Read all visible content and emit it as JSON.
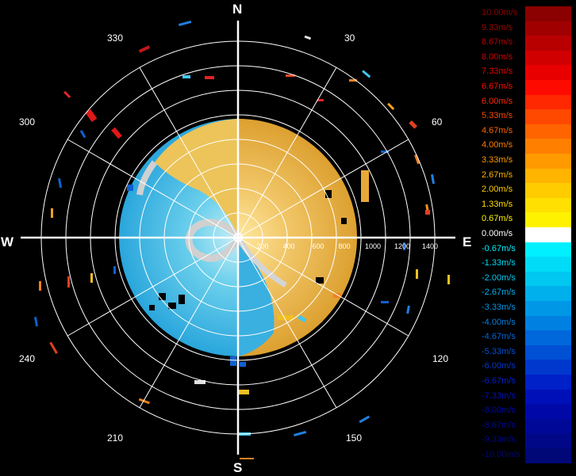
{
  "compass": {
    "n": "N",
    "e": "E",
    "s": "S",
    "w": "W"
  },
  "bearings": [
    "30",
    "60",
    "120",
    "150",
    "210",
    "240",
    "300",
    "330"
  ],
  "range_labels": [
    "200",
    "400",
    "600",
    "800",
    "1000",
    "1200",
    "1400"
  ],
  "legend": [
    {
      "label": "10.00m/s",
      "color": "#8b0000"
    },
    {
      "label": "9.33m/s",
      "color": "#a00000"
    },
    {
      "label": "8.67m/s",
      "color": "#b80000"
    },
    {
      "label": "8.00m/s",
      "color": "#d00000"
    },
    {
      "label": "7.33m/s",
      "color": "#e80000"
    },
    {
      "label": "6.67m/s",
      "color": "#ff0a00"
    },
    {
      "label": "6.00m/s",
      "color": "#ff2800"
    },
    {
      "label": "5.33m/s",
      "color": "#ff4800"
    },
    {
      "label": "4.67m/s",
      "color": "#ff6400"
    },
    {
      "label": "4.00m/s",
      "color": "#ff7f00"
    },
    {
      "label": "3.33m/s",
      "color": "#ff9a00"
    },
    {
      "label": "2.67m/s",
      "color": "#ffb400"
    },
    {
      "label": "2.00m/s",
      "color": "#ffcc00"
    },
    {
      "label": "1.33m/s",
      "color": "#ffe000"
    },
    {
      "label": "0.67m/s",
      "color": "#fff200"
    },
    {
      "label": "0.00m/s",
      "color": "#ffffff"
    },
    {
      "label": "-0.67m/s",
      "color": "#00f0ff"
    },
    {
      "label": "-1.33m/s",
      "color": "#00dcf8"
    },
    {
      "label": "-2.00m/s",
      "color": "#00c8f0"
    },
    {
      "label": "-2.67m/s",
      "color": "#00b0ec"
    },
    {
      "label": "-3.33m/s",
      "color": "#0098e6"
    },
    {
      "label": "-4.00m/s",
      "color": "#0080e0"
    },
    {
      "label": "-4.67m/s",
      "color": "#0068da"
    },
    {
      "label": "-5.33m/s",
      "color": "#0050d4"
    },
    {
      "label": "-6.00m/s",
      "color": "#0038ce"
    },
    {
      "label": "-6.67m/s",
      "color": "#0020c8"
    },
    {
      "label": "-7.33m/s",
      "color": "#0010b8"
    },
    {
      "label": "-8.00m/s",
      "color": "#0008a8"
    },
    {
      "label": "-8.67m/s",
      "color": "#000898"
    },
    {
      "label": "-9.33m/s",
      "color": "#000888"
    },
    {
      "label": "-10.00m/s",
      "color": "#000878"
    }
  ],
  "colors": {
    "background": "#000000",
    "grid": "#ffffff",
    "approaching": "#38b4e0",
    "receding": "#e8a838",
    "zero": "#d0d0d0"
  }
}
